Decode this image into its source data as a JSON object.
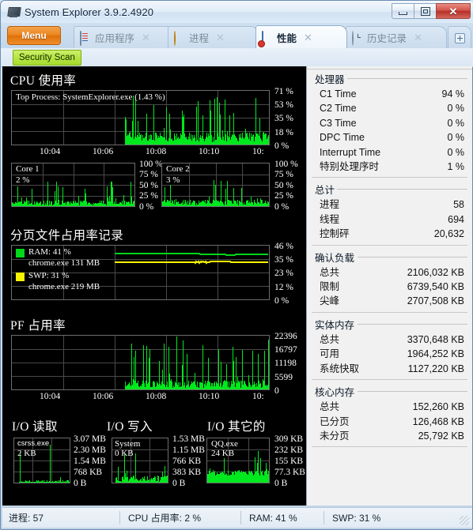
{
  "window": {
    "title": "System Explorer 3.9.2.4920",
    "icon": "app-icon",
    "minimize": "minimize",
    "maximize": "maximize",
    "close": "✕"
  },
  "tabbar": {
    "menu_label": "Menu",
    "add_tab_label": "+",
    "close_glyph": "✕",
    "tabs": [
      {
        "label": "应用程序",
        "icon": "document-icon",
        "active": false
      },
      {
        "label": "进程",
        "icon": "gear-icon",
        "active": false
      },
      {
        "label": "性能",
        "icon": "performance-icon",
        "active": true
      },
      {
        "label": "历史记录",
        "icon": "clock-icon",
        "active": false
      }
    ]
  },
  "toolbar": {
    "security_scan_label": "Security Scan"
  },
  "graphs": {
    "cpu": {
      "title": "CPU 使用率",
      "caption": "Top Process: SystemExplorer.exe (1.43 %)",
      "y_ticks": [
        "71 %",
        "53 %",
        "35 %",
        "18 %",
        "0 %"
      ],
      "x_ticks": [
        "10:04",
        "10:06",
        "10:08",
        "10:10",
        "10:"
      ]
    },
    "core1": {
      "caption_name": "Core 1",
      "caption_value": "2 %",
      "y_ticks": [
        "100 %",
        "75 %",
        "50 %",
        "25 %",
        "0 %"
      ]
    },
    "core2": {
      "caption_name": "Core 2",
      "caption_value": "3 %",
      "y_ticks": [
        "100 %",
        "75 %",
        "50 %",
        "25 %",
        "0 %"
      ]
    },
    "pagefile": {
      "title": "分页文件占用率记录",
      "legend": [
        {
          "color": "#00d61a",
          "label": "RAM: 41 %",
          "sub": "chrome.exe 131 MB"
        },
        {
          "color": "#f5f500",
          "label": "SWP: 31 %",
          "sub": "chrome.exe 219 MB"
        }
      ],
      "y_ticks": [
        "46 %",
        "35 %",
        "23 %",
        "12 %",
        "0 %"
      ]
    },
    "pf": {
      "title": "PF 占用率",
      "y_ticks": [
        "22396",
        "16797",
        "11198",
        "5599",
        "0"
      ],
      "x_ticks": [
        "10:04",
        "10:06",
        "10:08",
        "10:10",
        "10:"
      ]
    },
    "io": [
      {
        "title": "I/O 读取",
        "caption_name": "csrss.exe",
        "caption_value": "2 KB",
        "y_ticks": [
          "3.07 MB",
          "2.30 MB",
          "1.54 MB",
          "768 KB",
          "0 B"
        ]
      },
      {
        "title": "I/O 写入",
        "caption_name": "System",
        "caption_value": "0 KB",
        "y_ticks": [
          "1.53 MB",
          "1.15 MB",
          "766 KB",
          "383 KB",
          "0 B"
        ]
      },
      {
        "title": "I/O 其它的",
        "caption_name": "QQ.exe",
        "caption_value": "24 KB",
        "y_ticks": [
          "309 KB",
          "232 KB",
          "155 KB",
          "77.3 KB",
          "0 B"
        ]
      }
    ]
  },
  "stats": [
    {
      "header": "处理器",
      "rows": [
        {
          "k": "C1 Time",
          "v": "94 %"
        },
        {
          "k": "C2 Time",
          "v": "0 %"
        },
        {
          "k": "C3 Time",
          "v": "0 %"
        },
        {
          "k": "DPC Time",
          "v": "0 %"
        },
        {
          "k": "Interrupt Time",
          "v": "0 %"
        },
        {
          "k": "特别处理序时",
          "v": "1 %"
        }
      ]
    },
    {
      "header": "总计",
      "rows": [
        {
          "k": "进程",
          "v": "58"
        },
        {
          "k": "线程",
          "v": "694"
        },
        {
          "k": "控制砰",
          "v": "20,632"
        }
      ]
    },
    {
      "header": "确认负载",
      "rows": [
        {
          "k": "总共",
          "v": "2106,032 KB"
        },
        {
          "k": "限制",
          "v": "6739,540 KB"
        },
        {
          "k": "尖峰",
          "v": "2707,508 KB"
        }
      ]
    },
    {
      "header": "实体内存",
      "rows": [
        {
          "k": "总共",
          "v": "3370,648 KB"
        },
        {
          "k": "可用",
          "v": "1964,252 KB"
        },
        {
          "k": "系统快取",
          "v": "1127,220 KB"
        }
      ]
    },
    {
      "header": "核心内存",
      "rows": [
        {
          "k": "总共",
          "v": "152,260 KB"
        },
        {
          "k": "已分页",
          "v": "126,468 KB"
        },
        {
          "k": "未分页",
          "v": "25,792 KB"
        }
      ]
    }
  ],
  "statusbar": {
    "cells": [
      "进程: 57",
      "CPU 占用率: 2 %",
      "RAM: 41 %",
      "SWP: 31 %"
    ]
  },
  "chart_data": [
    {
      "type": "area",
      "name": "cpu-usage-history",
      "title": "CPU 使用率",
      "ylabel": "%",
      "ylim": [
        0,
        71
      ],
      "yticks": [
        0,
        18,
        35,
        53,
        71
      ],
      "xticks": [
        "10:04",
        "10:06",
        "10:08",
        "10:10",
        "10:"
      ],
      "grid": true,
      "color": "#00e81e",
      "annotation": "Top Process: SystemExplorer.exe (1.43 %)",
      "values": [
        0,
        0,
        0,
        0,
        0,
        0,
        0,
        0,
        0,
        0,
        0,
        0,
        0,
        0,
        0,
        0,
        0,
        0,
        0,
        0,
        0,
        0,
        0,
        0,
        0,
        0,
        0,
        0,
        0,
        0,
        0,
        0,
        0,
        0,
        0,
        0,
        0,
        0,
        0,
        0,
        0,
        0,
        0,
        0,
        0,
        0,
        0,
        0,
        0,
        0,
        0,
        0,
        0,
        0,
        0,
        0,
        0,
        0,
        0,
        0,
        0,
        0,
        0,
        0,
        0,
        0,
        0,
        0,
        0,
        0,
        0,
        0,
        0,
        0,
        0,
        0,
        0,
        0,
        0,
        0,
        0,
        0,
        0,
        0,
        0,
        0,
        0,
        0,
        0,
        0,
        0,
        0,
        0,
        0,
        0,
        0,
        0,
        0,
        0,
        0,
        0,
        0,
        0,
        0,
        0,
        0,
        0,
        0,
        0,
        0,
        0,
        0,
        0,
        0,
        0,
        0,
        0,
        0,
        0,
        0,
        0,
        0,
        0,
        0,
        0,
        0,
        0,
        0,
        0,
        0,
        0,
        0,
        0,
        0,
        0,
        0,
        0,
        0,
        0,
        0,
        0,
        0,
        0,
        0,
        12,
        53,
        10,
        22,
        8,
        30,
        6,
        18,
        7,
        26,
        9,
        14,
        6,
        35,
        11,
        28,
        7,
        20,
        5,
        45,
        13,
        24,
        9,
        31,
        6,
        17,
        8,
        22,
        5,
        12,
        6,
        9,
        5,
        14,
        7,
        11,
        4,
        8,
        5,
        19,
        6,
        10,
        4,
        13,
        6,
        9,
        3,
        7,
        4,
        12,
        5,
        8,
        3,
        9,
        4,
        6,
        3,
        10,
        5,
        7,
        4,
        13,
        6,
        9,
        5,
        16,
        7,
        11,
        4,
        8,
        5,
        12,
        6,
        9,
        4,
        14,
        7,
        10,
        5,
        8,
        4,
        11,
        6,
        9,
        5,
        13,
        7,
        10,
        4,
        8,
        5,
        22,
        9,
        15,
        6,
        30,
        12,
        19,
        7,
        33,
        14,
        21,
        8,
        26,
        10,
        17,
        6,
        39,
        15,
        24,
        9,
        28,
        11,
        18,
        7,
        46,
        19,
        30,
        12,
        22,
        9,
        35,
        14,
        24,
        10,
        40,
        16,
        27,
        11,
        33,
        13,
        21,
        8,
        37,
        15,
        25,
        10,
        29,
        12,
        20,
        8,
        44,
        18,
        28,
        11,
        24,
        9,
        31,
        13,
        21,
        8,
        26,
        10,
        17,
        7,
        22,
        9,
        15,
        6,
        34,
        14,
        23,
        9,
        19,
        7,
        52,
        21,
        33,
        13,
        25,
        10,
        20,
        8,
        28,
        11,
        18,
        7,
        23,
        9,
        16,
        6,
        20,
        8,
        14,
        6,
        25,
        10,
        17,
        7,
        21,
        8,
        15,
        6,
        19,
        8,
        13,
        5,
        17,
        7,
        12,
        5,
        44,
        18,
        29
      ]
    },
    {
      "type": "area",
      "name": "core1-usage",
      "title": "Core 1",
      "ylim": [
        0,
        100
      ],
      "yticks": [
        0,
        25,
        50,
        75,
        100
      ],
      "grid": true,
      "color": "#00e81e",
      "current_value": 2
    },
    {
      "type": "area",
      "name": "core2-usage",
      "title": "Core 2",
      "ylim": [
        0,
        100
      ],
      "yticks": [
        0,
        25,
        50,
        75,
        100
      ],
      "grid": true,
      "color": "#00e81e",
      "current_value": 3
    },
    {
      "type": "line",
      "name": "pagefile-usage-history",
      "title": "分页文件占用率记录",
      "ylim": [
        0,
        46
      ],
      "yticks": [
        0,
        12,
        23,
        35,
        46
      ],
      "grid": true,
      "series": [
        {
          "name": "RAM: 41 %",
          "color": "#00d61a",
          "value": 41
        },
        {
          "name": "SWP: 31 %",
          "color": "#f5f500",
          "value": 31
        }
      ]
    },
    {
      "type": "area",
      "name": "pf-usage-history",
      "title": "PF 占用率",
      "ylim": [
        0,
        22396
      ],
      "yticks": [
        0,
        5599,
        11198,
        16797,
        22396
      ],
      "xticks": [
        "10:04",
        "10:06",
        "10:08",
        "10:10",
        "10:"
      ],
      "grid": true,
      "color": "#00e81e"
    },
    {
      "type": "area",
      "name": "io-read-history",
      "title": "I/O 读取",
      "ylim": [
        0,
        3217981
      ],
      "yticks": [
        "0 B",
        "768 KB",
        "1.54 MB",
        "2.30 MB",
        "3.07 MB"
      ],
      "grid": true,
      "color": "#00e81e",
      "top_process": "csrss.exe",
      "current_value": "2 KB"
    },
    {
      "type": "area",
      "name": "io-write-history",
      "title": "I/O 写入",
      "ylim": [
        0,
        1604321
      ],
      "yticks": [
        "0 B",
        "383 KB",
        "766 KB",
        "1.15 MB",
        "1.53 MB"
      ],
      "grid": true,
      "color": "#00e81e",
      "top_process": "System",
      "current_value": "0 KB"
    },
    {
      "type": "area",
      "name": "io-other-history",
      "title": "I/O 其它的",
      "ylim": [
        0,
        316416
      ],
      "yticks": [
        "0 B",
        "77.3 KB",
        "155 KB",
        "232 KB",
        "309 KB"
      ],
      "grid": true,
      "color": "#00e81e",
      "top_process": "QQ.exe",
      "current_value": "24 KB"
    }
  ]
}
